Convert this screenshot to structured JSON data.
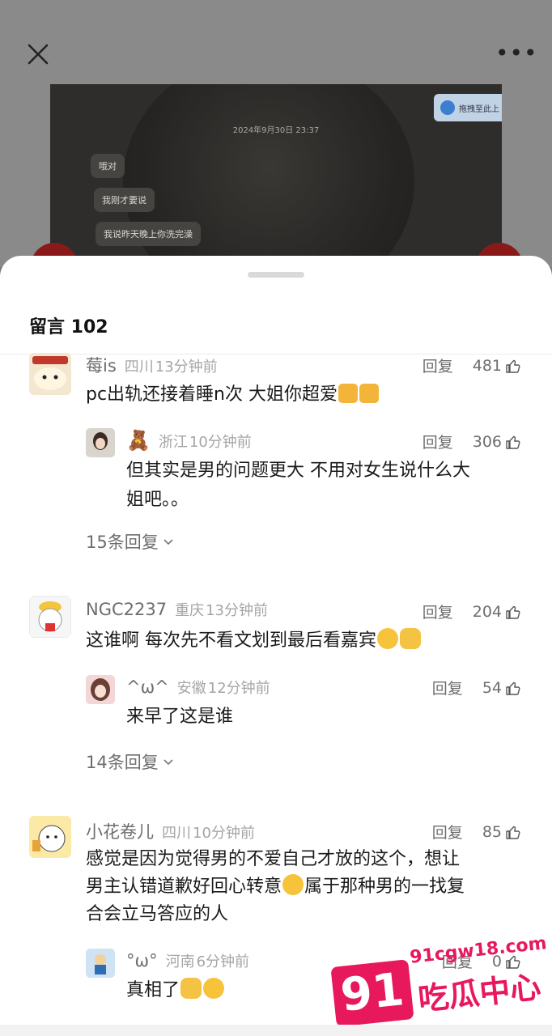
{
  "header": {
    "close_icon": "close-icon",
    "more_icon": "more-dots-icon",
    "more_glyph": "•••"
  },
  "photo": {
    "timestamp": "2024年9月30日 23:37",
    "cloud_badge": "拖拽至此上",
    "bubbles": [
      "哦对",
      "我刚才要说",
      "我说昨天晚上你洗完澡"
    ]
  },
  "sheet": {
    "title": "留言 102"
  },
  "threads": [
    {
      "comment": {
        "nick": "莓is",
        "location": "四川",
        "time": "13分钟前",
        "reply": "回复",
        "likes": "481",
        "text": "pc出轨还接着睡n次 大姐你超爱"
      },
      "reply": {
        "nick": "🧸",
        "location": "浙江",
        "time": "10分钟前",
        "reply": "回复",
        "likes": "306",
        "text_line1": "但其实是男的问题更大 不用对女生说什么大",
        "text_line2": "姐吧。。"
      },
      "more": "15条回复"
    },
    {
      "comment": {
        "nick": "NGC2237",
        "location": "重庆",
        "time": "13分钟前",
        "reply": "回复",
        "likes": "204",
        "text": "这谁啊 每次先不看文划到最后看嘉宾"
      },
      "reply": {
        "nick": "^ω^",
        "location": "安徽",
        "time": "12分钟前",
        "reply": "回复",
        "likes": "54",
        "text": "来早了这是谁"
      },
      "more": "14条回复"
    },
    {
      "comment": {
        "nick": "小花卷儿",
        "location": "四川",
        "time": "10分钟前",
        "reply": "回复",
        "likes": "85",
        "text_line1": "感觉是因为觉得男的不爱自己才放的这个，想让",
        "text_line2a": "男主认错道歉好回心转意",
        "text_line2b": "属于那种男的一找复",
        "text_line3": "合会立马答应的人"
      },
      "reply": {
        "nick": "°ω°",
        "location": "河南",
        "time": "6分钟前",
        "reply": "回复",
        "likes": "0",
        "text": "真相了"
      }
    }
  ],
  "watermark": {
    "url": "91cgw18.com",
    "logo_num": "91",
    "logo_text": "吃瓜中心"
  },
  "colors": {
    "accent": "#e8185d",
    "text": "#1a1a1a",
    "muted": "#a5a5a5"
  }
}
